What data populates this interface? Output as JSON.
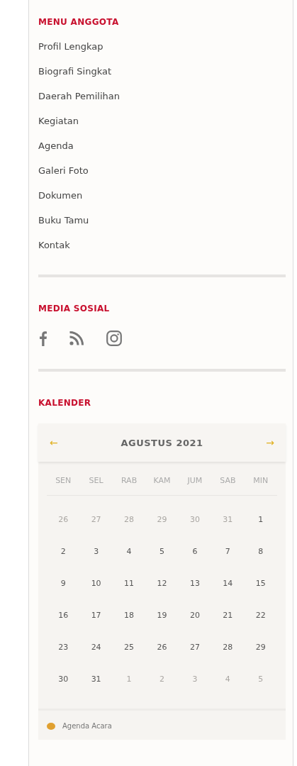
{
  "menu": {
    "title": "MENU ANGGOTA",
    "items": [
      "Profil Lengkap",
      "Biografi Singkat",
      "Daerah Pemilihan",
      "Kegiatan",
      "Agenda",
      "Galeri Foto",
      "Dokumen",
      "Buku Tamu",
      "Kontak"
    ]
  },
  "social": {
    "title": "MEDIA SOSIAL",
    "icons": [
      {
        "kind": "facebook"
      },
      {
        "kind": "rss"
      },
      {
        "kind": "instagram"
      }
    ]
  },
  "calendar": {
    "title": "KALENDER",
    "month": "AGUSTUS 2021",
    "prev": "←",
    "next": "→",
    "weekdays": [
      "SEN",
      "SEL",
      "RAB",
      "KAM",
      "JUM",
      "SAB",
      "MIN"
    ],
    "days": [
      {
        "label": "26",
        "muted": true
      },
      {
        "label": "27",
        "muted": true
      },
      {
        "label": "28",
        "muted": true
      },
      {
        "label": "29",
        "muted": true
      },
      {
        "label": "30",
        "muted": true
      },
      {
        "label": "31",
        "muted": true
      },
      {
        "label": "1",
        "muted": false
      },
      {
        "label": "2",
        "muted": false
      },
      {
        "label": "3",
        "muted": false
      },
      {
        "label": "4",
        "muted": false
      },
      {
        "label": "5",
        "muted": false
      },
      {
        "label": "6",
        "muted": false
      },
      {
        "label": "7",
        "muted": false
      },
      {
        "label": "8",
        "muted": false
      },
      {
        "label": "9",
        "muted": false
      },
      {
        "label": "10",
        "muted": false
      },
      {
        "label": "11",
        "muted": false
      },
      {
        "label": "12",
        "muted": false
      },
      {
        "label": "13",
        "muted": false
      },
      {
        "label": "14",
        "muted": false
      },
      {
        "label": "15",
        "muted": false
      },
      {
        "label": "16",
        "muted": false
      },
      {
        "label": "17",
        "muted": false
      },
      {
        "label": "18",
        "muted": false
      },
      {
        "label": "19",
        "muted": false
      },
      {
        "label": "20",
        "muted": false
      },
      {
        "label": "21",
        "muted": false
      },
      {
        "label": "22",
        "muted": false
      },
      {
        "label": "23",
        "muted": false
      },
      {
        "label": "24",
        "muted": false
      },
      {
        "label": "25",
        "muted": false
      },
      {
        "label": "26",
        "muted": false
      },
      {
        "label": "27",
        "muted": false
      },
      {
        "label": "28",
        "muted": false
      },
      {
        "label": "29",
        "muted": false
      },
      {
        "label": "30",
        "muted": false
      },
      {
        "label": "31",
        "muted": false
      },
      {
        "label": "1",
        "muted": true
      },
      {
        "label": "2",
        "muted": true
      },
      {
        "label": "3",
        "muted": true
      },
      {
        "label": "4",
        "muted": true
      },
      {
        "label": "5",
        "muted": true
      }
    ],
    "legend": [
      {
        "label": "Agenda Acara",
        "color": "#e0a030"
      }
    ]
  }
}
